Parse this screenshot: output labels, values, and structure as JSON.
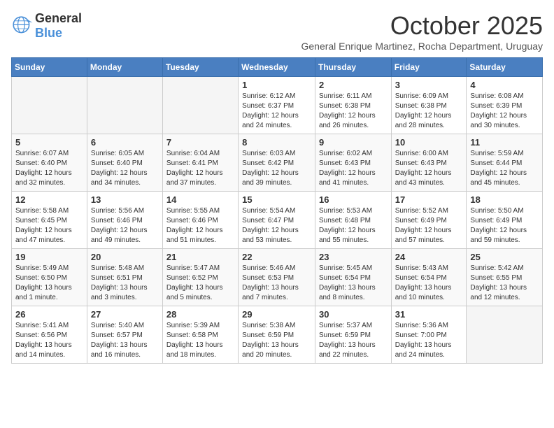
{
  "header": {
    "logo_general": "General",
    "logo_blue": "Blue",
    "month_title": "October 2025",
    "subtitle": "General Enrique Martinez, Rocha Department, Uruguay"
  },
  "days_of_week": [
    "Sunday",
    "Monday",
    "Tuesday",
    "Wednesday",
    "Thursday",
    "Friday",
    "Saturday"
  ],
  "weeks": [
    [
      {
        "day": "",
        "info": ""
      },
      {
        "day": "",
        "info": ""
      },
      {
        "day": "",
        "info": ""
      },
      {
        "day": "1",
        "info": "Sunrise: 6:12 AM\nSunset: 6:37 PM\nDaylight: 12 hours\nand 24 minutes."
      },
      {
        "day": "2",
        "info": "Sunrise: 6:11 AM\nSunset: 6:38 PM\nDaylight: 12 hours\nand 26 minutes."
      },
      {
        "day": "3",
        "info": "Sunrise: 6:09 AM\nSunset: 6:38 PM\nDaylight: 12 hours\nand 28 minutes."
      },
      {
        "day": "4",
        "info": "Sunrise: 6:08 AM\nSunset: 6:39 PM\nDaylight: 12 hours\nand 30 minutes."
      }
    ],
    [
      {
        "day": "5",
        "info": "Sunrise: 6:07 AM\nSunset: 6:40 PM\nDaylight: 12 hours\nand 32 minutes."
      },
      {
        "day": "6",
        "info": "Sunrise: 6:05 AM\nSunset: 6:40 PM\nDaylight: 12 hours\nand 34 minutes."
      },
      {
        "day": "7",
        "info": "Sunrise: 6:04 AM\nSunset: 6:41 PM\nDaylight: 12 hours\nand 37 minutes."
      },
      {
        "day": "8",
        "info": "Sunrise: 6:03 AM\nSunset: 6:42 PM\nDaylight: 12 hours\nand 39 minutes."
      },
      {
        "day": "9",
        "info": "Sunrise: 6:02 AM\nSunset: 6:43 PM\nDaylight: 12 hours\nand 41 minutes."
      },
      {
        "day": "10",
        "info": "Sunrise: 6:00 AM\nSunset: 6:43 PM\nDaylight: 12 hours\nand 43 minutes."
      },
      {
        "day": "11",
        "info": "Sunrise: 5:59 AM\nSunset: 6:44 PM\nDaylight: 12 hours\nand 45 minutes."
      }
    ],
    [
      {
        "day": "12",
        "info": "Sunrise: 5:58 AM\nSunset: 6:45 PM\nDaylight: 12 hours\nand 47 minutes."
      },
      {
        "day": "13",
        "info": "Sunrise: 5:56 AM\nSunset: 6:46 PM\nDaylight: 12 hours\nand 49 minutes."
      },
      {
        "day": "14",
        "info": "Sunrise: 5:55 AM\nSunset: 6:46 PM\nDaylight: 12 hours\nand 51 minutes."
      },
      {
        "day": "15",
        "info": "Sunrise: 5:54 AM\nSunset: 6:47 PM\nDaylight: 12 hours\nand 53 minutes."
      },
      {
        "day": "16",
        "info": "Sunrise: 5:53 AM\nSunset: 6:48 PM\nDaylight: 12 hours\nand 55 minutes."
      },
      {
        "day": "17",
        "info": "Sunrise: 5:52 AM\nSunset: 6:49 PM\nDaylight: 12 hours\nand 57 minutes."
      },
      {
        "day": "18",
        "info": "Sunrise: 5:50 AM\nSunset: 6:49 PM\nDaylight: 12 hours\nand 59 minutes."
      }
    ],
    [
      {
        "day": "19",
        "info": "Sunrise: 5:49 AM\nSunset: 6:50 PM\nDaylight: 13 hours\nand 1 minute."
      },
      {
        "day": "20",
        "info": "Sunrise: 5:48 AM\nSunset: 6:51 PM\nDaylight: 13 hours\nand 3 minutes."
      },
      {
        "day": "21",
        "info": "Sunrise: 5:47 AM\nSunset: 6:52 PM\nDaylight: 13 hours\nand 5 minutes."
      },
      {
        "day": "22",
        "info": "Sunrise: 5:46 AM\nSunset: 6:53 PM\nDaylight: 13 hours\nand 7 minutes."
      },
      {
        "day": "23",
        "info": "Sunrise: 5:45 AM\nSunset: 6:54 PM\nDaylight: 13 hours\nand 8 minutes."
      },
      {
        "day": "24",
        "info": "Sunrise: 5:43 AM\nSunset: 6:54 PM\nDaylight: 13 hours\nand 10 minutes."
      },
      {
        "day": "25",
        "info": "Sunrise: 5:42 AM\nSunset: 6:55 PM\nDaylight: 13 hours\nand 12 minutes."
      }
    ],
    [
      {
        "day": "26",
        "info": "Sunrise: 5:41 AM\nSunset: 6:56 PM\nDaylight: 13 hours\nand 14 minutes."
      },
      {
        "day": "27",
        "info": "Sunrise: 5:40 AM\nSunset: 6:57 PM\nDaylight: 13 hours\nand 16 minutes."
      },
      {
        "day": "28",
        "info": "Sunrise: 5:39 AM\nSunset: 6:58 PM\nDaylight: 13 hours\nand 18 minutes."
      },
      {
        "day": "29",
        "info": "Sunrise: 5:38 AM\nSunset: 6:59 PM\nDaylight: 13 hours\nand 20 minutes."
      },
      {
        "day": "30",
        "info": "Sunrise: 5:37 AM\nSunset: 6:59 PM\nDaylight: 13 hours\nand 22 minutes."
      },
      {
        "day": "31",
        "info": "Sunrise: 5:36 AM\nSunset: 7:00 PM\nDaylight: 13 hours\nand 24 minutes."
      },
      {
        "day": "",
        "info": ""
      }
    ]
  ]
}
